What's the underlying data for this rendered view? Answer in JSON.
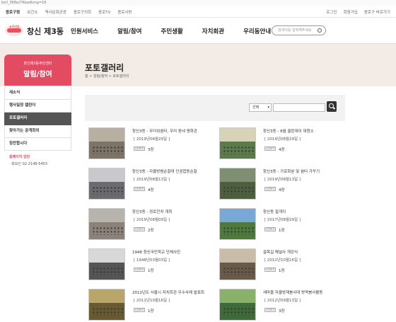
{
  "browser": {
    "url": "ko/l_368e2?Keadlong=16"
  },
  "topbar": {
    "home": "종로구청",
    "links": [
      "보건소",
      "역사문화관광",
      "종로구의회",
      "종로TV",
      "종로사랑"
    ],
    "right_links": [
      "로그인",
      "회원가입",
      "종로구 바로가기"
    ]
  },
  "header": {
    "logo_mark": "★우리동",
    "site_title": "창신 제3동",
    "nav": [
      "민원서비스",
      "알림/참여",
      "주민생활",
      "자치회관",
      "우리동안내"
    ],
    "search_placeholder": "검색어를 입력해주세요"
  },
  "lnb": {
    "subtitle": "창신제3동주민센터",
    "title": "알림/참여",
    "items": [
      "새소식",
      "행사일정 캘린더",
      "포토갤러리",
      "찾아가는 공개회의",
      "칭찬합시다"
    ],
    "active_index": 2,
    "contact_title": "홈페이지 담당",
    "contact_phone": "· 회보인 02-2148-5453"
  },
  "main": {
    "title": "포토갤러리",
    "breadcrumb": "홈 > 알림/참여 > 포토갤러리",
    "filter_select": "선택",
    "filter_input": ""
  },
  "gallery": [
    {
      "title": "창신3동 - 무더위쉼터, 우리 동네 명화관",
      "date": "[ 2019년08월29일 ]",
      "view": "사진보기",
      "count": "3장",
      "sky": "#b7b0a2",
      "ground": "#7d7468"
    },
    {
      "title": "창신3동 - 8월 클린데이 대청소",
      "date": "[ 2019년08월29일 ]",
      "view": "사진보기",
      "count": "4장",
      "sky": "#d8d2b6",
      "ground": "#5d7a4c"
    },
    {
      "title": "창신3동 - 자율방범순찰대 인권합동순찰",
      "date": "[ 2019년08월13일 ]",
      "view": "사진보기",
      "count": "4장",
      "sky": "#c7c9cc",
      "ground": "#6b6a6e"
    },
    {
      "title": "창신3동 - 가로화분 및 쉼터 가꾸기",
      "date": "[ 2019년08월13일 ]",
      "view": "사진보기",
      "count": "4장",
      "sky": "#7e8f74",
      "ground": "#4d5f3e"
    },
    {
      "title": "창신3동 - 경로잔치 개최",
      "date": "[ 2019년08월09일 ]",
      "view": "사진보기",
      "count": "2장",
      "sky": "#b7b4ad",
      "ground": "#8b8379"
    },
    {
      "title": "창신동 절개지",
      "date": "[ 2017년08월29일 ]",
      "view": "사진보기",
      "count": "1장",
      "sky": "#79a7d6",
      "ground": "#4f7a3d"
    },
    {
      "title": "1948 창신국민학교 단체사진",
      "date": "[ 1948년03월03일 ]",
      "view": "사진보기",
      "count": "1장",
      "sky": "#d8d8d8",
      "ground": "#555555"
    },
    {
      "title": "골목길 해설사 개강식",
      "date": "[ 2012년10월16일 ]",
      "view": "사진보기",
      "count": "1장",
      "sky": "#c9bda9",
      "ground": "#6a5a4a"
    },
    {
      "title": "2012년도 서울시 자치회관 우수사례 발표회",
      "date": "[ 2012년10월16일 ]",
      "view": "사진보기",
      "count": "1장",
      "sky": "#b8a56a",
      "ground": "#6a5a34"
    },
    {
      "title": "새마을 자율방재봉사대 방역봉사활동",
      "date": "[ 2012년09월13일 ]",
      "view": "사진보기",
      "count": "3장",
      "sky": "#89b16a",
      "ground": "#3f6a3a"
    }
  ]
}
